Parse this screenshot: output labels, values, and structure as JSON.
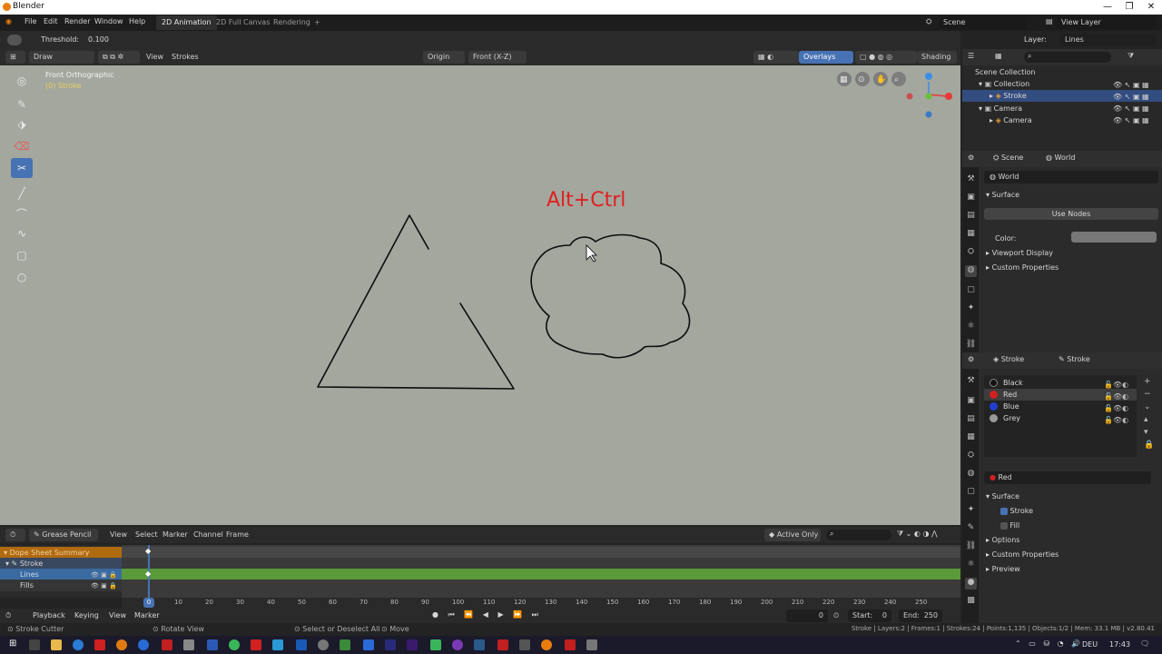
{
  "window": {
    "title": "Blender"
  },
  "menu": {
    "file": "File",
    "edit": "Edit",
    "render": "Render",
    "window": "Window",
    "help": "Help"
  },
  "workspaces": {
    "ws1": "2D Animation",
    "ws2": "2D Full Canvas",
    "ws3": "Rendering",
    "add": "+"
  },
  "scene": {
    "label": "Scene",
    "view_layer": "View Layer"
  },
  "tool_header": {
    "threshold_label": "Threshold:",
    "threshold_value": "0.100",
    "layer_label": "Layer:",
    "layer_value": "Lines"
  },
  "viewport_header": {
    "mode": "Draw",
    "view": "View",
    "strokes": "Strokes",
    "origin": "Origin",
    "orientation": "Front (X-Z)",
    "overlays": "Overlays",
    "shading": "Shading"
  },
  "viewport": {
    "view_name": "Front Orthographic",
    "object_name": "(0) Stroke",
    "annotation": "Alt+Ctrl"
  },
  "outliner": {
    "scene_collection": "Scene Collection",
    "rows": [
      {
        "label": "Collection"
      },
      {
        "label": "Stroke"
      },
      {
        "label": "Camera"
      },
      {
        "label": "Camera"
      }
    ]
  },
  "world_props": {
    "tab_scene": "Scene",
    "tab_world": "World",
    "world_name": "World",
    "surface": "Surface",
    "use_nodes": "Use Nodes",
    "color_label": "Color:",
    "viewport_display": "Viewport Display",
    "custom_properties": "Custom Properties"
  },
  "material_props": {
    "tab_stroke1": "Stroke",
    "tab_stroke2": "Stroke",
    "materials": [
      {
        "name": "Black",
        "color": "#111111"
      },
      {
        "name": "Red",
        "color": "#d02020"
      },
      {
        "name": "Blue",
        "color": "#2040d0"
      },
      {
        "name": "Grey",
        "color": "#9a9a9a"
      }
    ],
    "active_material": "Red",
    "surface": "Surface",
    "stroke": "Stroke",
    "fill": "Fill",
    "options": "Options",
    "custom_properties": "Custom Properties",
    "preview": "Preview"
  },
  "timeline": {
    "editor": "Grease Pencil",
    "view": "View",
    "select": "Select",
    "marker": "Marker",
    "channel": "Channel",
    "frame": "Frame",
    "active_only": "Active Only",
    "channels": [
      "Dope Sheet Summary",
      "Stroke",
      "Lines",
      "Fills"
    ],
    "ticks": [
      "0",
      "10",
      "20",
      "30",
      "40",
      "50",
      "60",
      "70",
      "80",
      "90",
      "100",
      "110",
      "120",
      "130",
      "140",
      "150",
      "160",
      "170",
      "180",
      "190",
      "200",
      "210",
      "220",
      "230",
      "240",
      "250"
    ],
    "playback": "Playback",
    "keying": "Keying",
    "view2": "View",
    "marker2": "Marker",
    "current_frame": "0",
    "start_label": "Start:",
    "start_value": "0",
    "end_label": "End:",
    "end_value": "250"
  },
  "status": {
    "left": "Stroke Cutter",
    "mid1": "Rotate View",
    "mid2": "Select or Deselect All",
    "mid3": "Move",
    "right": "Stroke | Layers:2 | Frames:1 | Strokes:24 | Points:1,135 | Objects:1/2 | Mem: 33.1 MB | v2.80.41"
  },
  "taskbar": {
    "lang": "DEU",
    "time": "17:43"
  }
}
